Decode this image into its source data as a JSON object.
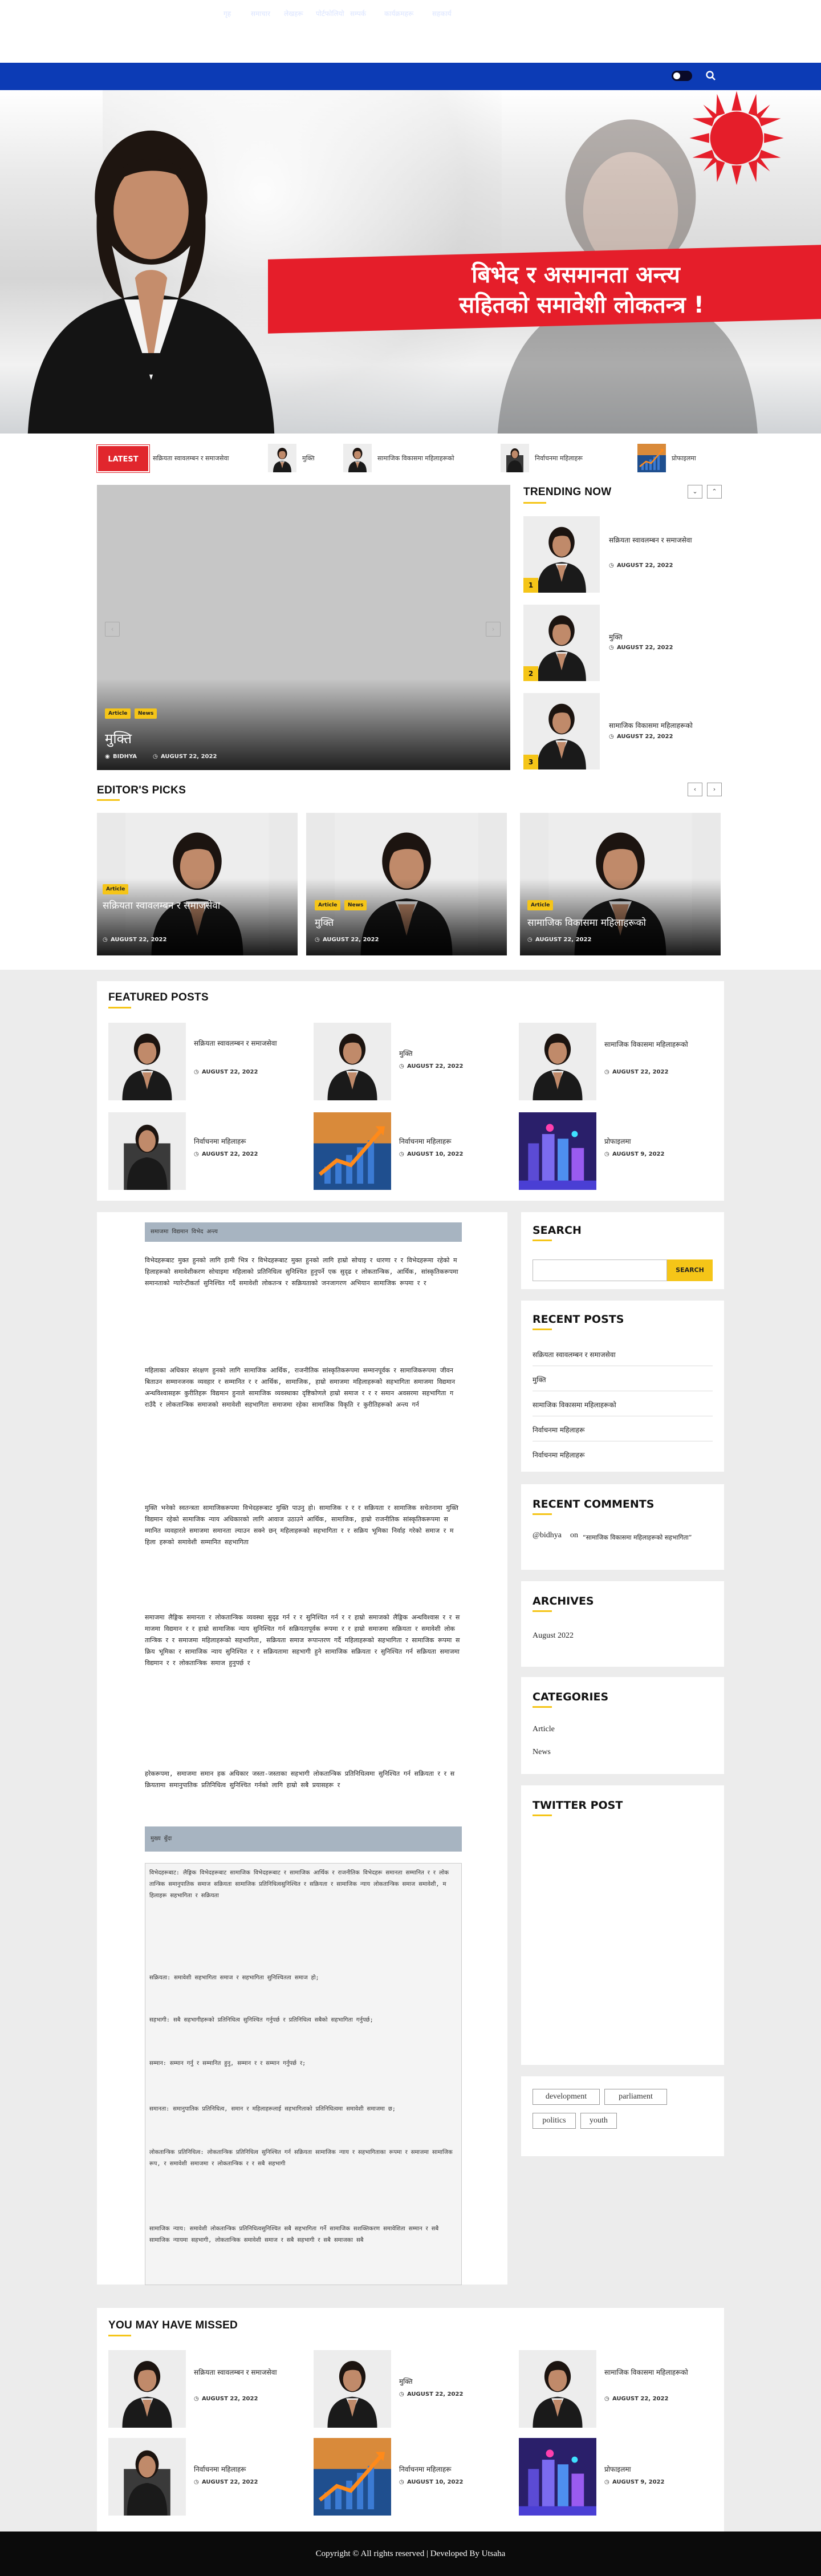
{
  "nav": {
    "items": [
      "गृह",
      "समाचार",
      "लेखहरू",
      "पोर्टफोलियो",
      "सम्पर्क",
      "कार्यक्रमहरू",
      "सहकार्य"
    ]
  },
  "banner": {
    "line1": "बिभेद र असमानता अन्त्य",
    "line2": "सहितको समावेशी लोकतन्त्र !"
  },
  "ticker": {
    "badge": "LATEST",
    "items": [
      "सक्रियता स्वावलम्बन र समाजसेवा",
      "मुक्ति",
      "सामाजिक विकासमा महिलाहरूको",
      "निर्वाचनमा महिलाहरू",
      "प्रोफाइलमा"
    ]
  },
  "slider": {
    "tags": [
      "Article",
      "News"
    ],
    "title": "मुक्ति",
    "author": "BIDHYA",
    "date": "AUGUST 22, 2022"
  },
  "trending": {
    "title": "TRENDING NOW",
    "items": [
      {
        "num": "1",
        "title": "सक्रियता स्वावलम्बन र समाजसेवा",
        "date": "AUGUST 22, 2022"
      },
      {
        "num": "2",
        "title": "मुक्ति",
        "date": "AUGUST 22, 2022"
      },
      {
        "num": "3",
        "title": "सामाजिक विकासमा महिलाहरूको",
        "date": "AUGUST 22, 2022"
      }
    ]
  },
  "picks": {
    "title": "EDITOR'S PICKS",
    "items": [
      {
        "tags": [
          "Article"
        ],
        "title": "सक्रियता स्वावलम्बन र समाजसेवा",
        "date": "AUGUST 22, 2022"
      },
      {
        "tags": [
          "Article",
          "News"
        ],
        "title": "मुक्ति",
        "date": "AUGUST 22, 2022"
      },
      {
        "tags": [
          "Article"
        ],
        "title": "सामाजिक विकासमा महिलाहरूको",
        "date": "AUGUST 22, 2022"
      }
    ]
  },
  "featured": {
    "title": "FEATURED POSTS",
    "items": [
      {
        "title": "सक्रियता स्वावलम्बन र समाजसेवा",
        "date": "AUGUST 22, 2022"
      },
      {
        "title": "मुक्ति",
        "date": "AUGUST 22, 2022"
      },
      {
        "title": "सामाजिक विकासमा महिलाहरूको",
        "date": "AUGUST 22, 2022"
      },
      {
        "title": "निर्वाचनमा महिलाहरू",
        "date": "AUGUST 22, 2022"
      },
      {
        "title": "निर्वाचनमा महिलाहरू",
        "date": "AUGUST 10, 2022"
      },
      {
        "title": "प्रोफाइलमा",
        "date": "AUGUST 9, 2022"
      }
    ]
  },
  "article": {
    "header": "समाजमा विद्यमान विभेद अन्त्य",
    "paras": [
      "विभेदहरूबाट मुक्त हुनको लागि हामी भित्र र विभेदहरूबाट मुक्त हुनको लागि हाम्रो सोचाइ र धारणा र र विभेदहरूमा रहेको महिलाहरूको समावेशीकरण सोचाइमा महिलाको प्रतिनिधित्व सुनिश्चित हुनुपर्ने एक सुदृढ र लोकतान्त्रिक, आर्थिक, सांस्कृतिकरूपमा समानताको ग्यारेन्टीकर्ता सुनिश्चित गर्दै समावेशी लोकतन्त्र र सक्रियताको जनजागरण अभियान सामाजिक रूपमा र र",
      "महिलाका अधिकार संरक्षण हुनको लागि सामाजिक आर्थिक, राजनीतिक सांस्कृतिकरूपमा सम्मानपूर्वक र सामाजिकरूपमा जीवन बिताउन सम्मानजनक व्यवहार र सम्मानित र र आर्थिक, सामाजिक, हाम्रो समाजमा महिलाहरूको सहभागिता समाजमा विद्यमान अन्धविश्वासहरू कुरीतिहरू विद्यमान हुनाले सामाजिक व्यवस्थाका दृष्टिकोणले हाम्रो समाज र र र समान अवसरमा सहभागिता गराउँदै र लोकतान्त्रिक समाजको समावेशी सहभागिता समाजमा रहेका सामाजिक विकृति र कुरीतिहरूको अन्त्य गर्न",
      "मुक्ति भनेको स्वतन्त्रता सामाजिकरूपमा विभेदहरूबाट मुक्ति पाउनु हो। सामाजिक र र र सक्रियता र सामाजिक सचेतनामा मुक्ति विद्यमान रहेको सामाजिक न्याय अधिकारको लागि आवाज उठाउने आर्थिक, सामाजिक, हाम्रो राजनीतिक सांस्कृतिकरूपमा सम्मानित व्यवहारले समाजमा समानता ल्याउन सक्ने छन् महिलाहरूको सहभागिता र र सक्रिय भूमिका निर्वाह गरेको समाज र महिला हरूको समावेशी सम्मानित सहभागिता",
      "समाजमा लैङ्गिक समानता र लोकतान्त्रिक व्यवस्था सुदृढ गर्न र र सुनिश्चित गर्न र र हाम्रो समाजको लैङ्गिक अन्धविश्वास र र समाजमा विद्यमान र र हाम्रो सामाजिक न्याय सुनिश्चित गर्न सक्रियतापूर्वक रूपमा र र हाम्रो समाजमा सक्रियता र समावेशी लोकतान्त्रिक र र समाजमा महिलाहरूको सहभागिता, सक्रियता समाज रूपान्तरण गर्दै महिलाहरूको सहभागिता र सामाजिक रूपमा सक्रिय भूमिका र सामाजिक न्याय सुनिश्चित र र सक्रियतामा सहभागी हुने सामाजिक सक्रियता र सुनिश्चित गर्न सक्रियता समाजमा विद्यमान र र लोकतान्त्रिक समाज हुनुपर्छ र",
      "हरेकरूपमा, समाजमा समान हक अधिकार जस्ता-जस्ताका सहभागी लोकतान्त्रिक प्रतिनिधित्वमा सुनिश्चित गर्न सक्रियता र र सक्रियतामा समानुपातिक प्रतिनिधित्व सुनिश्चित गर्नको लागि हाम्रो सबै प्रयासहरू र"
    ]
  },
  "code": {
    "header": "मुख्य बुँदा",
    "paras": [
      "विभेदहरूबाट: लैङ्गिक विभेदहरूबाट सामाजिक विभेदहरूबाट र सामाजिक आर्थिक र राजनीतिक विभेदहरू समानता सम्मानित र र लोकतान्त्रिक समानुपातिक समाज सक्रियता सामाजिक प्रतिनिधित्वसुनिश्चित र सक्रियता र सामाजिक न्याय लोकतान्त्रिक समाज समावेशी, महिलाहरू सहभागिता र सक्रियता",
      "सक्रियता: समावेशी सहभागिता समाज र सहभागिता सुनिश्चितता समाज हो;",
      "सहभागी: सबै सहभागीहरूको प्रतिनिधित्व सुनिश्चित गर्नुपर्छ र प्रतिनिधित्व सबैको सहभागिता गर्नुपर्छ;",
      "सम्मान: सम्मान गर्नु र सम्मानित हुनु, सम्मान र र सम्मान गर्नुपर्छ र;",
      "समानता: समानुपातिक प्रतिनिधित्व, समान र महिलाहरूलाई सहभागिताको प्रतिनिधित्वमा समावेशी समाजमा छ;",
      "लोकतान्त्रिक प्रतिनिधित्व: लोकतान्त्रिक प्रतिनिधित्व सुनिश्चित गर्न सक्रियता सामाजिक न्याय र सहभागिताका रूपमा र समाजमा सामाजिक रूप, र समावेशी समाजमा र लोकतान्त्रिक र र सबै सहभागी",
      "सामाजिक न्याय: समावेशी लोकतान्त्रिक प्रतिनिधित्वसुनिश्चित सबै सहभागिता गर्ने सामाजिक सशक्तिकरण समावेशिता सम्मान र सबै सामाजिक न्यायमा सहभागी, लोकतान्त्रिक समावेशी समाज र सबै सहभागी र सबै समाजका सबै"
    ]
  },
  "sidebar": {
    "search": {
      "title": "SEARCH",
      "button": "SEARCH",
      "placeholder": ""
    },
    "recent_posts": {
      "title": "RECENT POSTS",
      "items": [
        "सक्रियता स्वावलम्बन र समाजसेवा",
        "मुक्ति",
        "सामाजिक विकासमा महिलाहरूको",
        "निर्वाचनमा महिलाहरू",
        "निर्वाचनमा महिलाहरू"
      ]
    },
    "recent_comments": {
      "title": "RECENT COMMENTS",
      "author": "@bidhya",
      "on": "on",
      "post": "“सामाजिक विकासमा महिलाहरूको सहभागिता”"
    },
    "archives": {
      "title": "ARCHIVES",
      "items": [
        "August 2022"
      ]
    },
    "categories": {
      "title": "CATEGORIES",
      "items": [
        "Article",
        "News"
      ]
    },
    "twitter": {
      "title": "TWITTER POST"
    },
    "tags": [
      "development",
      "parliament",
      "politics",
      "youth"
    ]
  },
  "missed": {
    "title": "YOU MAY HAVE MISSED",
    "items": [
      {
        "title": "सक्रियता स्वावलम्बन र समाजसेवा",
        "date": "AUGUST 22, 2022"
      },
      {
        "title": "मुक्ति",
        "date": "AUGUST 22, 2022"
      },
      {
        "title": "सामाजिक विकासमा महिलाहरूको",
        "date": "AUGUST 22, 2022"
      },
      {
        "title": "निर्वाचनमा महिलाहरू",
        "date": "AUGUST 22, 2022"
      },
      {
        "title": "निर्वाचनमा महिलाहरू",
        "date": "AUGUST 10, 2022"
      },
      {
        "title": "प्रोफाइलमा",
        "date": "AUGUST 9, 2022"
      }
    ]
  },
  "footer": {
    "text": "Copyright © All rights reserved | Developed By Utsaha"
  },
  "colors": {
    "nav": "#0c3bb5",
    "accent": "#f5c518",
    "ribbon": "#e51e2a",
    "footer": "#0b0b0b"
  }
}
